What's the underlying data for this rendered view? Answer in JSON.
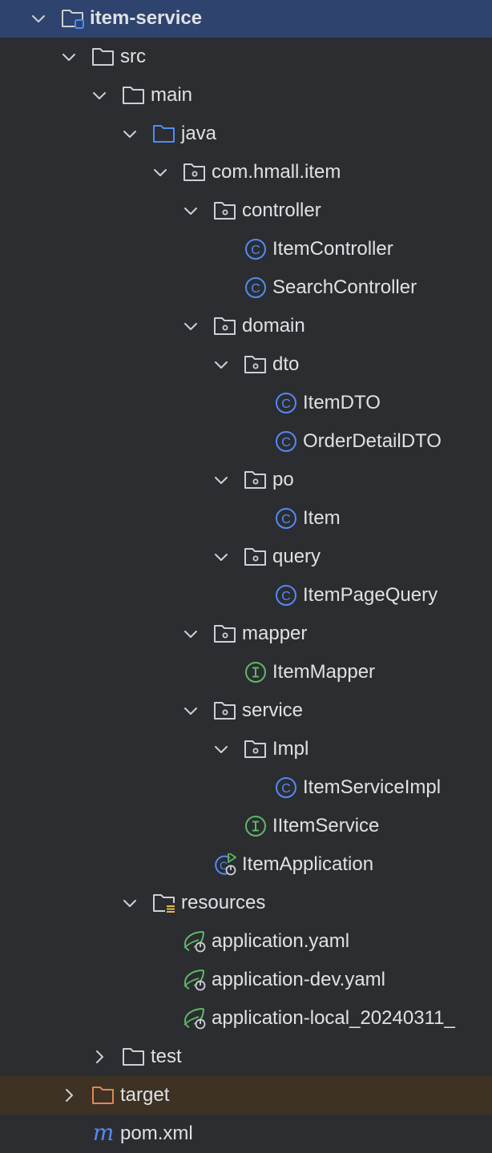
{
  "theme": {
    "background": "#2b2d30",
    "selection": "#2e436e",
    "excluded_row": "#3d3223",
    "text": "#dfe1e5",
    "folder_outline": "#ced0d6",
    "source_folder": "#548af7",
    "class_icon": "#548af7",
    "interface_icon": "#5fb865",
    "spring_icon": "#5fb865",
    "excluded_folder": "#e08855",
    "maven_icon": "#548af7"
  },
  "tree": {
    "items": [
      {
        "label": "item-service",
        "depth": 0,
        "icon": "module-folder-icon",
        "arrow": "expanded",
        "state": "selected",
        "bold": true
      },
      {
        "label": "src",
        "depth": 1,
        "icon": "folder-icon",
        "arrow": "expanded"
      },
      {
        "label": "main",
        "depth": 2,
        "icon": "folder-icon",
        "arrow": "expanded"
      },
      {
        "label": "java",
        "depth": 3,
        "icon": "source-folder-icon",
        "arrow": "expanded"
      },
      {
        "label": "com.hmall.item",
        "depth": 4,
        "icon": "package-icon",
        "arrow": "expanded"
      },
      {
        "label": "controller",
        "depth": 5,
        "icon": "package-icon",
        "arrow": "expanded"
      },
      {
        "label": "ItemController",
        "depth": 6,
        "icon": "class-icon",
        "arrow": "none"
      },
      {
        "label": "SearchController",
        "depth": 6,
        "icon": "class-icon",
        "arrow": "none"
      },
      {
        "label": "domain",
        "depth": 5,
        "icon": "package-icon",
        "arrow": "expanded"
      },
      {
        "label": "dto",
        "depth": 6,
        "icon": "package-icon",
        "arrow": "expanded"
      },
      {
        "label": "ItemDTO",
        "depth": 7,
        "icon": "class-icon",
        "arrow": "none"
      },
      {
        "label": "OrderDetailDTO",
        "depth": 7,
        "icon": "class-icon",
        "arrow": "none"
      },
      {
        "label": "po",
        "depth": 6,
        "icon": "package-icon",
        "arrow": "expanded"
      },
      {
        "label": "Item",
        "depth": 7,
        "icon": "class-icon",
        "arrow": "none"
      },
      {
        "label": "query",
        "depth": 6,
        "icon": "package-icon",
        "arrow": "expanded"
      },
      {
        "label": "ItemPageQuery",
        "depth": 7,
        "icon": "class-icon",
        "arrow": "none"
      },
      {
        "label": "mapper",
        "depth": 5,
        "icon": "package-icon",
        "arrow": "expanded"
      },
      {
        "label": "ItemMapper",
        "depth": 6,
        "icon": "interface-icon",
        "arrow": "none"
      },
      {
        "label": "service",
        "depth": 5,
        "icon": "package-icon",
        "arrow": "expanded"
      },
      {
        "label": "Impl",
        "depth": 6,
        "icon": "package-icon",
        "arrow": "expanded"
      },
      {
        "label": "ItemServiceImpl",
        "depth": 7,
        "icon": "class-icon",
        "arrow": "none"
      },
      {
        "label": "IItemService",
        "depth": 6,
        "icon": "interface-icon",
        "arrow": "none"
      },
      {
        "label": "ItemApplication",
        "depth": 5,
        "icon": "spring-boot-class-icon",
        "arrow": "none"
      },
      {
        "label": "resources",
        "depth": 3,
        "icon": "resources-folder-icon",
        "arrow": "expanded"
      },
      {
        "label": "application.yaml",
        "depth": 4,
        "icon": "spring-config-icon",
        "arrow": "none"
      },
      {
        "label": "application-dev.yaml",
        "depth": 4,
        "icon": "spring-config-icon",
        "arrow": "none"
      },
      {
        "label": "application-local_20240311_",
        "depth": 4,
        "icon": "spring-config-icon",
        "arrow": "none"
      },
      {
        "label": "test",
        "depth": 2,
        "icon": "folder-icon",
        "arrow": "collapsed"
      },
      {
        "label": "target",
        "depth": 1,
        "icon": "excluded-folder-icon",
        "arrow": "collapsed",
        "state": "excluded"
      },
      {
        "label": "pom.xml",
        "depth": 1,
        "icon": "maven-icon",
        "arrow": "none"
      }
    ]
  }
}
